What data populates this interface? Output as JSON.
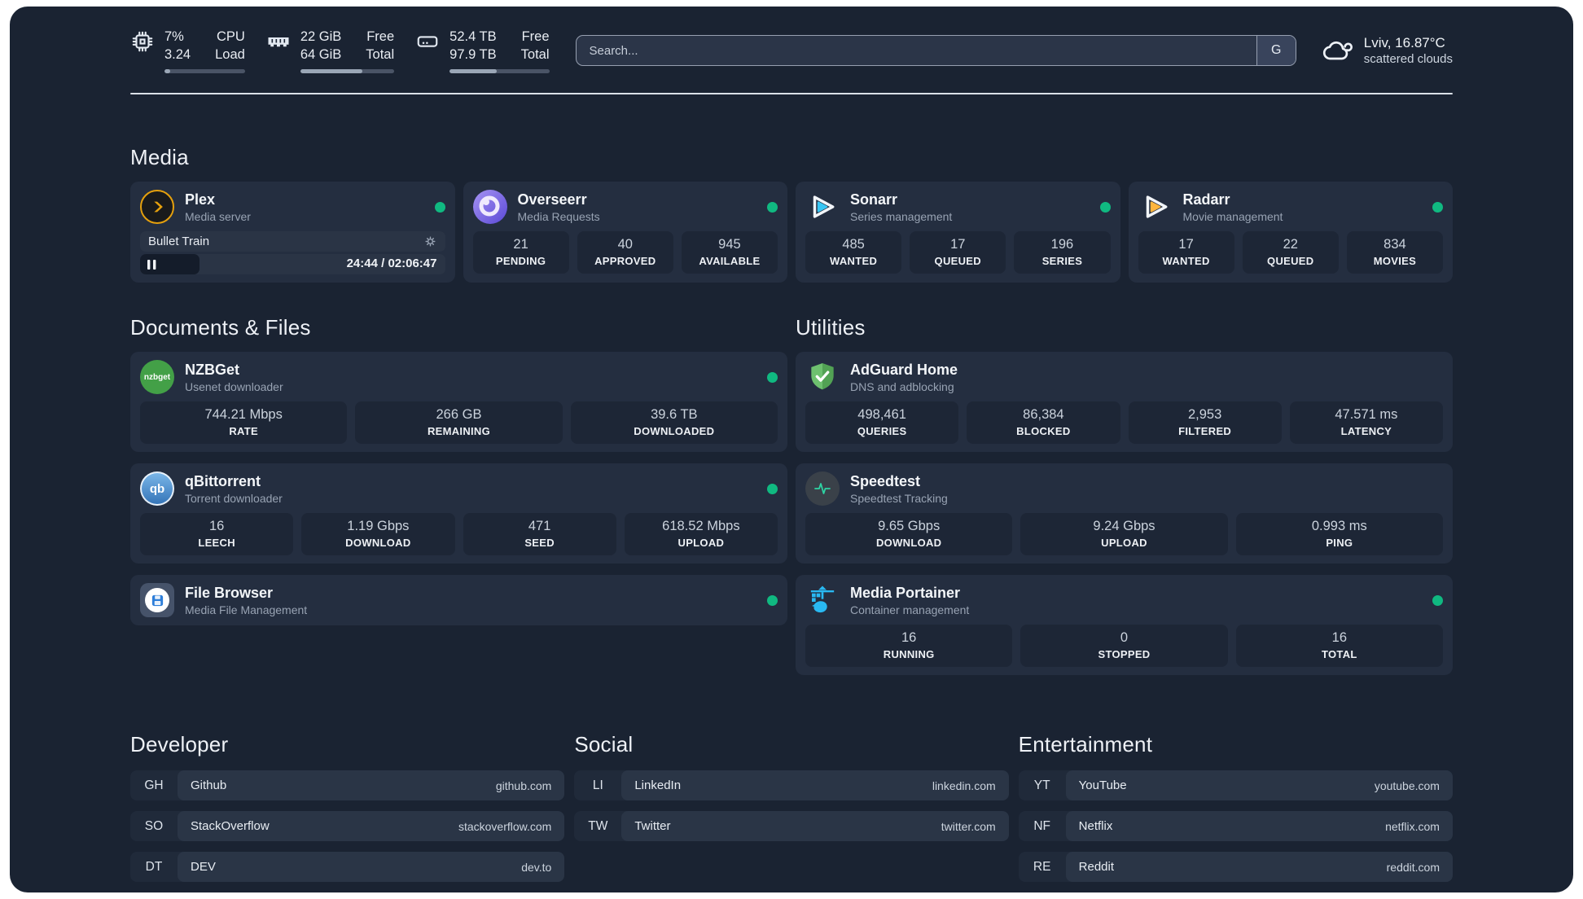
{
  "header": {
    "stats": {
      "cpu": {
        "icon": "cpu-chip",
        "line1": "7%",
        "line2": "3.24",
        "label1": "CPU",
        "label2": "Load",
        "progress": 7
      },
      "memory": {
        "icon": "ram-stick",
        "line1": "22 GiB",
        "line2": "64 GiB",
        "label1": "Free",
        "label2": "Total",
        "progress": 66
      },
      "disk": {
        "icon": "hard-drive",
        "line1": "52.4 TB",
        "line2": "97.9 TB",
        "label1": "Free",
        "label2": "Total",
        "progress": 47
      }
    },
    "search": {
      "placeholder": "Search...",
      "engine_button": "G"
    },
    "weather": {
      "icon": "scattered-clouds",
      "line1": "Lviv, 16.87°C",
      "line2": "scattered clouds"
    }
  },
  "sections": {
    "media": "Media",
    "documents": "Documents & Files",
    "utilities": "Utilities",
    "developer": "Developer",
    "social": "Social",
    "entertainment": "Entertainment"
  },
  "apps": {
    "plex": {
      "name": "Plex",
      "desc": "Media server",
      "now_playing": {
        "title": "Bullet Train",
        "time": "24:44 / 02:06:47",
        "progress": 19.5
      }
    },
    "overseerr": {
      "name": "Overseerr",
      "desc": "Media Requests",
      "stats": [
        {
          "value": "21",
          "label": "PENDING"
        },
        {
          "value": "40",
          "label": "APPROVED"
        },
        {
          "value": "945",
          "label": "AVAILABLE"
        }
      ]
    },
    "sonarr": {
      "name": "Sonarr",
      "desc": "Series management",
      "stats": [
        {
          "value": "485",
          "label": "WANTED"
        },
        {
          "value": "17",
          "label": "QUEUED"
        },
        {
          "value": "196",
          "label": "SERIES"
        }
      ]
    },
    "radarr": {
      "name": "Radarr",
      "desc": "Movie management",
      "stats": [
        {
          "value": "17",
          "label": "WANTED"
        },
        {
          "value": "22",
          "label": "QUEUED"
        },
        {
          "value": "834",
          "label": "MOVIES"
        }
      ]
    },
    "nzbget": {
      "name": "NZBGet",
      "desc": "Usenet downloader",
      "icon_text": "nzbget",
      "stats": [
        {
          "value": "744.21 Mbps",
          "label": "RATE"
        },
        {
          "value": "266 GB",
          "label": "REMAINING"
        },
        {
          "value": "39.6 TB",
          "label": "DOWNLOADED"
        }
      ]
    },
    "qbittorrent": {
      "name": "qBittorrent",
      "desc": "Torrent downloader",
      "icon_text": "qb",
      "stats": [
        {
          "value": "16",
          "label": "LEECH"
        },
        {
          "value": "1.19 Gbps",
          "label": "DOWNLOAD"
        },
        {
          "value": "471",
          "label": "SEED"
        },
        {
          "value": "618.52 Mbps",
          "label": "UPLOAD"
        }
      ]
    },
    "filebrowser": {
      "name": "File Browser",
      "desc": "Media File Management"
    },
    "adguard": {
      "name": "AdGuard Home",
      "desc": "DNS and adblocking",
      "stats": [
        {
          "value": "498,461",
          "label": "QUERIES"
        },
        {
          "value": "86,384",
          "label": "BLOCKED"
        },
        {
          "value": "2,953",
          "label": "FILTERED"
        },
        {
          "value": "47.571 ms",
          "label": "LATENCY"
        }
      ]
    },
    "speedtest": {
      "name": "Speedtest",
      "desc": "Speedtest Tracking",
      "stats": [
        {
          "value": "9.65 Gbps",
          "label": "DOWNLOAD"
        },
        {
          "value": "9.24 Gbps",
          "label": "UPLOAD"
        },
        {
          "value": "0.993 ms",
          "label": "PING"
        }
      ]
    },
    "portainer": {
      "name": "Media Portainer",
      "desc": "Container management",
      "stats": [
        {
          "value": "16",
          "label": "RUNNING"
        },
        {
          "value": "0",
          "label": "STOPPED"
        },
        {
          "value": "16",
          "label": "TOTAL"
        }
      ]
    }
  },
  "bookmarks": {
    "developer": [
      {
        "abbr": "GH",
        "name": "Github",
        "url": "github.com"
      },
      {
        "abbr": "SO",
        "name": "StackOverflow",
        "url": "stackoverflow.com"
      },
      {
        "abbr": "DT",
        "name": "DEV",
        "url": "dev.to"
      }
    ],
    "social": [
      {
        "abbr": "LI",
        "name": "LinkedIn",
        "url": "linkedin.com"
      },
      {
        "abbr": "TW",
        "name": "Twitter",
        "url": "twitter.com"
      }
    ],
    "entertainment": [
      {
        "abbr": "YT",
        "name": "YouTube",
        "url": "youtube.com"
      },
      {
        "abbr": "NF",
        "name": "Netflix",
        "url": "netflix.com"
      },
      {
        "abbr": "RE",
        "name": "Reddit",
        "url": "reddit.com"
      }
    ]
  },
  "colors": {
    "status_online": "#10b981",
    "plex_accent": "#e5a00d",
    "sonarr_accent": "#38c6f4",
    "radarr_accent": "#ffb53d",
    "portainer_accent": "#29b9f2"
  }
}
